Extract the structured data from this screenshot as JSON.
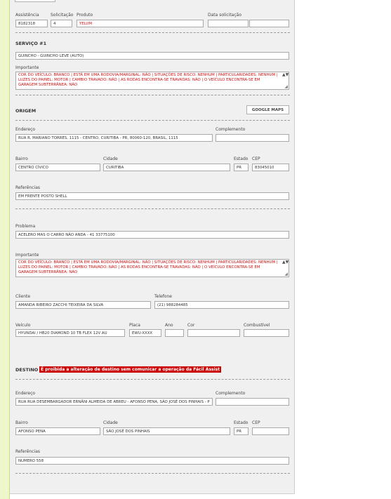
{
  "header": {
    "assistencia_label": "Assistência",
    "assistencia_value": "8182318",
    "solicitacao_label": "Solicitação",
    "solicitacao_value": "4",
    "produto_label": "Produto",
    "produto_value": "YELUM",
    "data_solicitacao_label": "Data solicitação",
    "data_value": "",
    "hora_value": ""
  },
  "servico": {
    "title": "SERVIÇO #1",
    "value": "GUINCHO - GUINCHO LEVE (AUTO)",
    "importante_label": "Importante",
    "importante_text": "COR DO VEÍCULO: BRANCO | ESTÁ EM UMA RODOVIA/MARGINAL: NÃO | SITUAÇÕES DE RISCO: NENHUM | PARTICULARIDADES: NENHUM | LUZES DO PAINEL: MOTOR | CAMBIO TRAVADO: NÃO | AS RODAS ENCONTRA-SE TRAVADAS: NÃO | O VEÍCULO ENCONTRA-SE EM GARAGEM SUBTERRÂNEA: NÃO"
  },
  "origem": {
    "title": "ORIGEM",
    "google_maps_button": "GOOGLE MAPS",
    "endereco_label": "Endereço",
    "endereco_value": "RUA R. MARIANO TORRES, 1115 - CENTRO, CURITIBA - PR, 80060-120, BRASIL, 1115",
    "complemento_label": "Complemento",
    "complemento_value": "",
    "bairro_label": "Bairro",
    "bairro_value": "CENTRO CÍVICO",
    "cidade_label": "Cidade",
    "cidade_value": "CURITIBA",
    "estado_label": "Estado",
    "estado_value": "PR",
    "cep_label": "CEP",
    "cep_value": "83045010",
    "referencias_label": "Referências",
    "referencias_value": "EM FRENTE POSTO SHELL"
  },
  "problema": {
    "label": "Problema",
    "value": "ACELERO MAS O CARRO NÃO ANDA - 41      33775100",
    "importante_label": "Importante",
    "importante_text": "COR DO VEÍCULO: BRANCO | ESTÁ EM UMA RODOVIA/MARGINAL: NÃO | SITUAÇÕES DE RISCO: NENHUM | PARTICULARIDADES: NENHUM | LUZES DO PAINEL: MOTOR | CAMBIO TRAVADO: NÃO | AS RODAS ENCONTRA-SE TRAVADAS: NÃO | O VEÍCULO ENCONTRA-SE EM GARAGEM SUBTERRÂNEA: NÃO"
  },
  "cliente": {
    "cliente_label": "Cliente",
    "cliente_value": "AMANDA RIBEIRO ZACCHI TEIXEIRA DA SILVA",
    "telefone_label": "Telefone",
    "telefone_value": "(21) 988284485"
  },
  "veiculo": {
    "veiculo_label": "Veículo",
    "veiculo_value": "HYUNDAI / HB20 DIAMOND 10 TB FLEX 12V AU",
    "placa_label": "Placa",
    "placa_value": "EWU-XXXX",
    "ano_label": "Ano",
    "ano_value": "",
    "cor_label": "Cor",
    "cor_value": "",
    "combustivel_label": "Combustível",
    "combustivel_value": ""
  },
  "destino": {
    "title": "DESTINO",
    "warning": "É proibida a alteração de destino sem comunicar a operação da Fácil Assist",
    "endereco_label": "Endereço",
    "endereco_value": "RUA RUA DESEMBARGADOR ERNÂNI ALMEIDA DE ABREU - AFONSO PENA, SÃO JOSÉ DOS PINHAIS - P",
    "complemento_label": "Complemento",
    "complemento_value": "",
    "bairro_label": "Bairro",
    "bairro_value": "AFONSO PENA",
    "cidade_label": "Cidade",
    "cidade_value": "SÃO JOSÉ DOS PINHAIS",
    "estado_label": "Estado",
    "estado_value": "PR",
    "cep_label": "CEP",
    "cep_value": "",
    "referencias_label": "Referências",
    "referencias_value": "NUMERO 558"
  },
  "icons": {
    "scroll_up_down": "▲▼",
    "resize_grip": "◢"
  }
}
